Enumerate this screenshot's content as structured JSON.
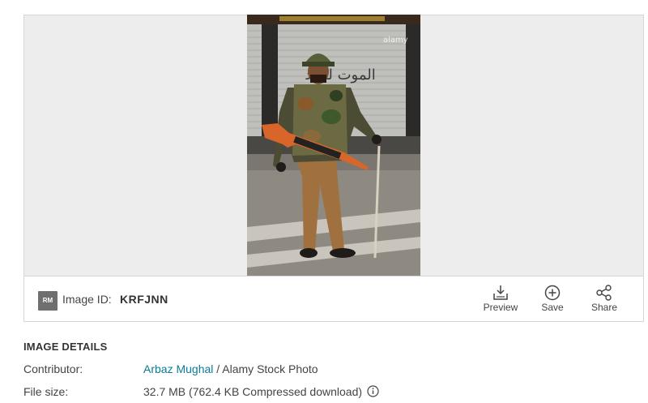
{
  "image_bar": {
    "badge": "RM",
    "id_label": "Image ID:",
    "id_value": "KRFJNN",
    "actions": {
      "preview": "Preview",
      "save": "Save",
      "share": "Share"
    }
  },
  "photo": {
    "watermark": "alamy",
    "wall_text": "الموت للهند"
  },
  "details": {
    "title": "IMAGE DETAILS",
    "contributor_label": "Contributor:",
    "contributor_name": "Arbaz Mughal",
    "contributor_suffix": " / Alamy Stock Photo",
    "file_size_label": "File size:",
    "file_size_value": "32.7 MB (762.4 KB Compressed download)"
  },
  "colors": {
    "link": "#0a7c94",
    "badge": "#6f6f6f",
    "viewer_bg": "#ededed"
  }
}
